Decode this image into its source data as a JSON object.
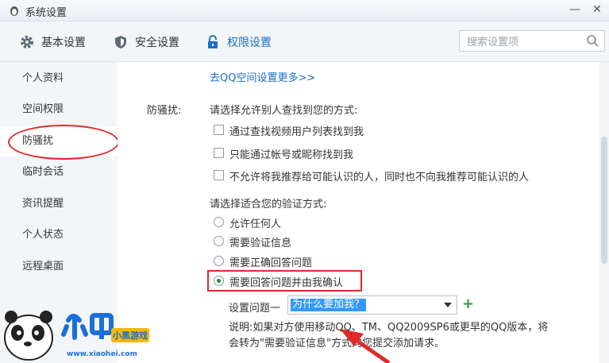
{
  "window": {
    "title": "系统设置",
    "minimize": "—",
    "close": "✕"
  },
  "tabs": [
    {
      "label": "基本设置",
      "icon": "gear-icon"
    },
    {
      "label": "安全设置",
      "icon": "shield-icon"
    },
    {
      "label": "权限设置",
      "icon": "lock-icon",
      "active": true
    }
  ],
  "search": {
    "placeholder": "搜索设置项"
  },
  "sidebar": {
    "items": [
      {
        "label": "个人资料"
      },
      {
        "label": "空间权限"
      },
      {
        "label": "防骚扰",
        "active": true
      },
      {
        "label": "临时会话"
      },
      {
        "label": "资讯提醒"
      },
      {
        "label": "个人状态"
      },
      {
        "label": "远程桌面"
      }
    ]
  },
  "main": {
    "more_link": "去QQ空间设置更多>>",
    "section_label": "防骚扰:",
    "find_question": "请选择允许别人查找到您的方式:",
    "find_options": [
      {
        "label": "通过查找视频用户列表找到我",
        "checked": false
      },
      {
        "label": "只能通过帐号或昵称找到我",
        "checked": false
      },
      {
        "label": "不允许将我推荐给可能认识的人，同时也不向我推荐可能认识的人",
        "checked": false
      }
    ],
    "verify_question": "请选择适合您的验证方式:",
    "verify_options": [
      {
        "label": "允许任何人",
        "selected": false
      },
      {
        "label": "需要验证信息",
        "selected": false
      },
      {
        "label": "需要正确回答问题",
        "selected": false
      },
      {
        "label": "需要回答问题并由我确认",
        "selected": true
      }
    ],
    "question_label": "设置问题一",
    "question_value": "为什么要加我？",
    "note_line1": "说明:如果对方使用移动QQ、TM、QQ2009SP6或更早的QQ版本，将",
    "note_line2": "会转为\"需要验证信息\"方式向您提交添加请求。"
  },
  "watermark": {
    "text": "小黑游戏",
    "url": "www.xiaohei.com"
  },
  "colors": {
    "accent": "#1a6fc7",
    "highlight_red": "#e02a2a",
    "radio_green": "#1f8f3a"
  }
}
